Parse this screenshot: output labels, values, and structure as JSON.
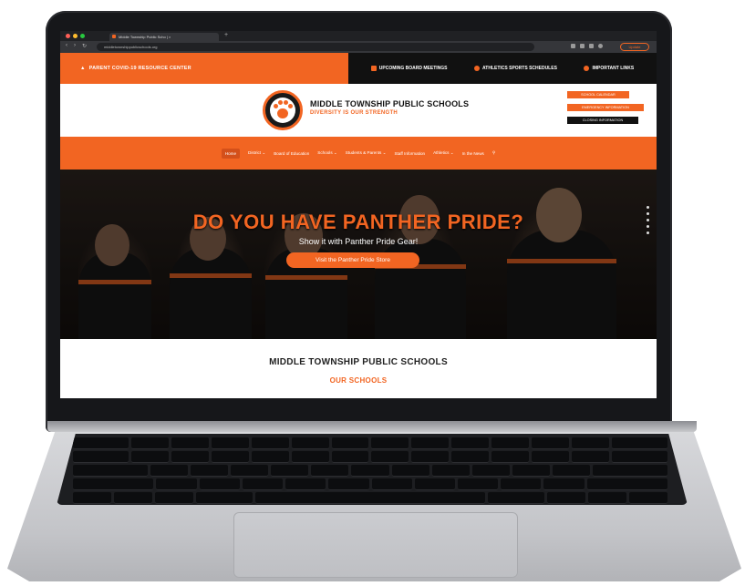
{
  "browser": {
    "tab_title": "Middle Township Public Scho | ×",
    "tab_close": "×",
    "new_tab": "+",
    "url": "middletownshippublicschools.org",
    "profile_label": "Update"
  },
  "topbar": {
    "alert_text": "PARENT COVID-19 RESOURCE CENTER",
    "links": [
      {
        "label": "UPCOMING BOARD MEETINGS",
        "icon": "calendar-icon"
      },
      {
        "label": "ATHLETICS SPORTS SCHEDULES",
        "icon": "person-icon"
      },
      {
        "label": "IMPORTANT LINKS",
        "icon": "link-icon"
      }
    ]
  },
  "header": {
    "title": "MIDDLE TOWNSHIP PUBLIC SCHOOLS",
    "tagline": "DIVERSITY IS OUR STRENGTH",
    "buttons": [
      {
        "label": "SCHOOL CALENDAR"
      },
      {
        "label": "EMERGENCY INFORMATION"
      },
      {
        "label": "CLOSING INFORMATION"
      }
    ]
  },
  "menu": {
    "items": [
      {
        "label": "Home"
      },
      {
        "label": "District ⌄"
      },
      {
        "label": "Board of Education"
      },
      {
        "label": "Schools ⌄"
      },
      {
        "label": "Students & Parents ⌄"
      },
      {
        "label": "Staff Information"
      },
      {
        "label": "Athletics ⌄"
      },
      {
        "label": "In the News"
      }
    ],
    "search_icon": "search-icon"
  },
  "hero": {
    "title": "DO YOU HAVE PANTHER PRIDE?",
    "subtitle": "Show it with Panther Pride Gear!",
    "button": "Visit the Panther Pride Store"
  },
  "content": {
    "title": "MIDDLE TOWNSHIP PUBLIC SCHOOLS",
    "subtitle": "OUR SCHOOLS"
  },
  "colors": {
    "brand_orange": "#f26522",
    "dark": "#111111"
  }
}
